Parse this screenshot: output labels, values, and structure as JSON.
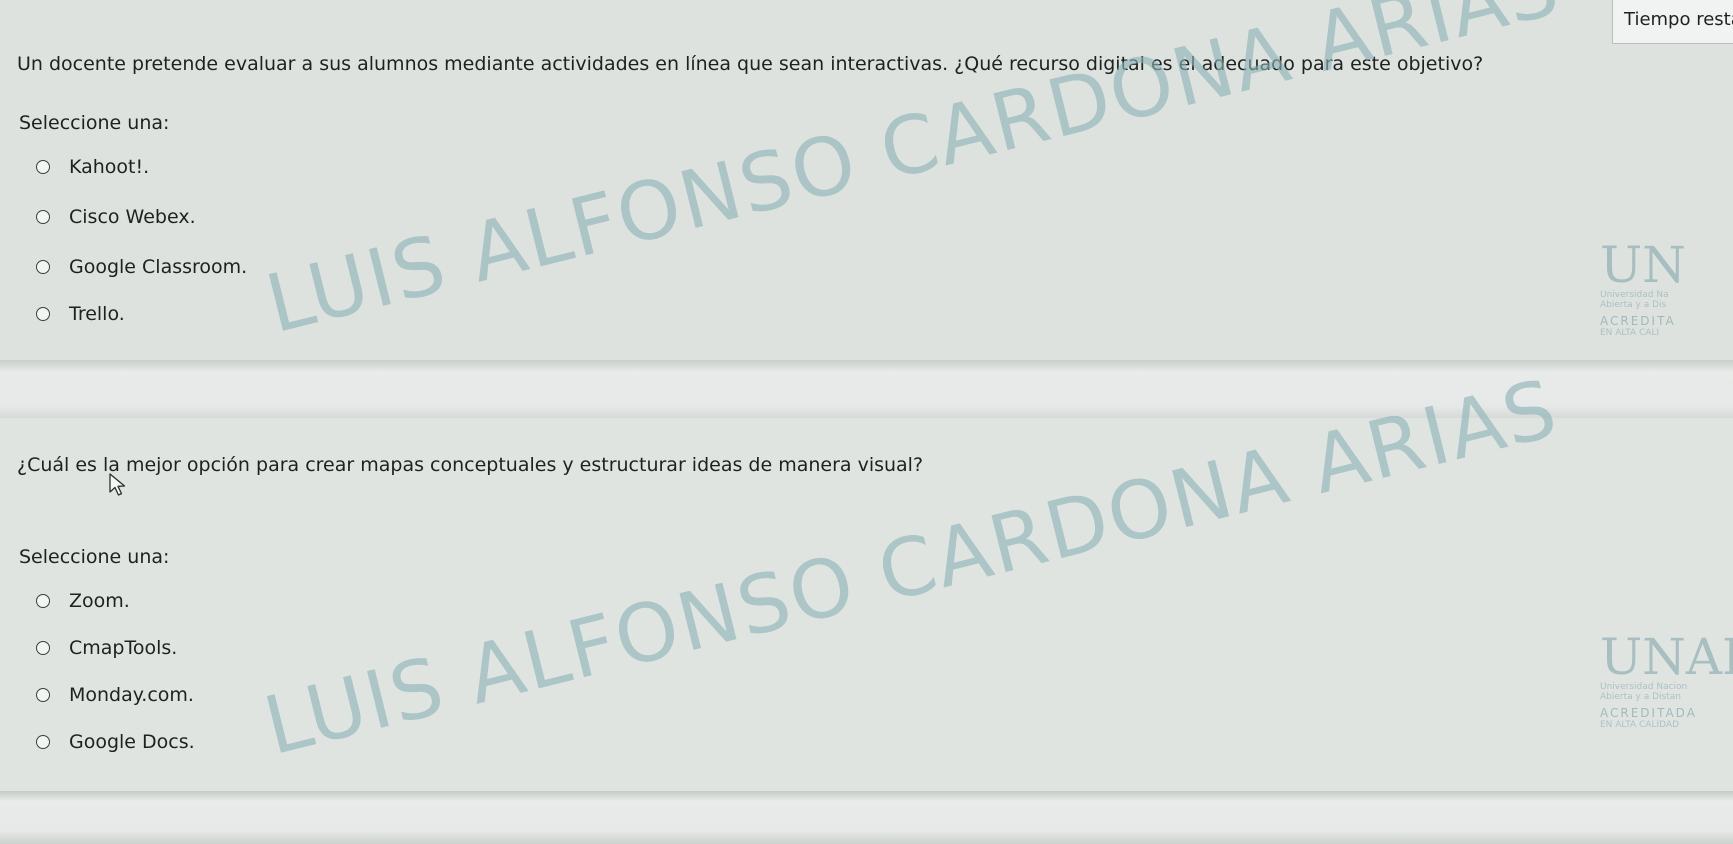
{
  "timer": {
    "label": "Tiempo restan"
  },
  "questions": [
    {
      "text": "Un docente pretende evaluar a sus alumnos mediante actividades en línea que sean interactivas. ¿Qué recurso digital es el adecuado para este objetivo?",
      "select_label": "Seleccione una:",
      "options": [
        "Kahoot!.",
        "Cisco Webex.",
        "Google Classroom.",
        "Trello."
      ],
      "watermark": "LUIS ALFONSO CARDONA ARIAS",
      "logo": {
        "mark": "UN",
        "line1": "Universidad Na",
        "line2": "Abierta y a Dis",
        "accred": "ACREDITA",
        "accred2": "EN ALTA CALI"
      }
    },
    {
      "text": "¿Cuál es la mejor opción para crear mapas conceptuales y estructurar ideas de manera visual?",
      "select_label": "Seleccione una:",
      "options": [
        "Zoom.",
        "CmapTools.",
        "Monday.com.",
        "Google Docs."
      ],
      "watermark": "LUIS ALFONSO CARDONA ARIAS",
      "logo": {
        "mark": "UNAD",
        "line1": "Universidad Nacion",
        "line2": "Abierta y a Distan",
        "accred": "ACREDITADA",
        "accred2": "EN ALTA CALIDAD"
      }
    }
  ],
  "colors": {
    "background": "#dfe4e0",
    "watermark": "#8db2b6",
    "text": "#1d2220"
  },
  "icons": {
    "radio": "radio-unchecked-icon",
    "cursor": "mouse-pointer-icon"
  }
}
